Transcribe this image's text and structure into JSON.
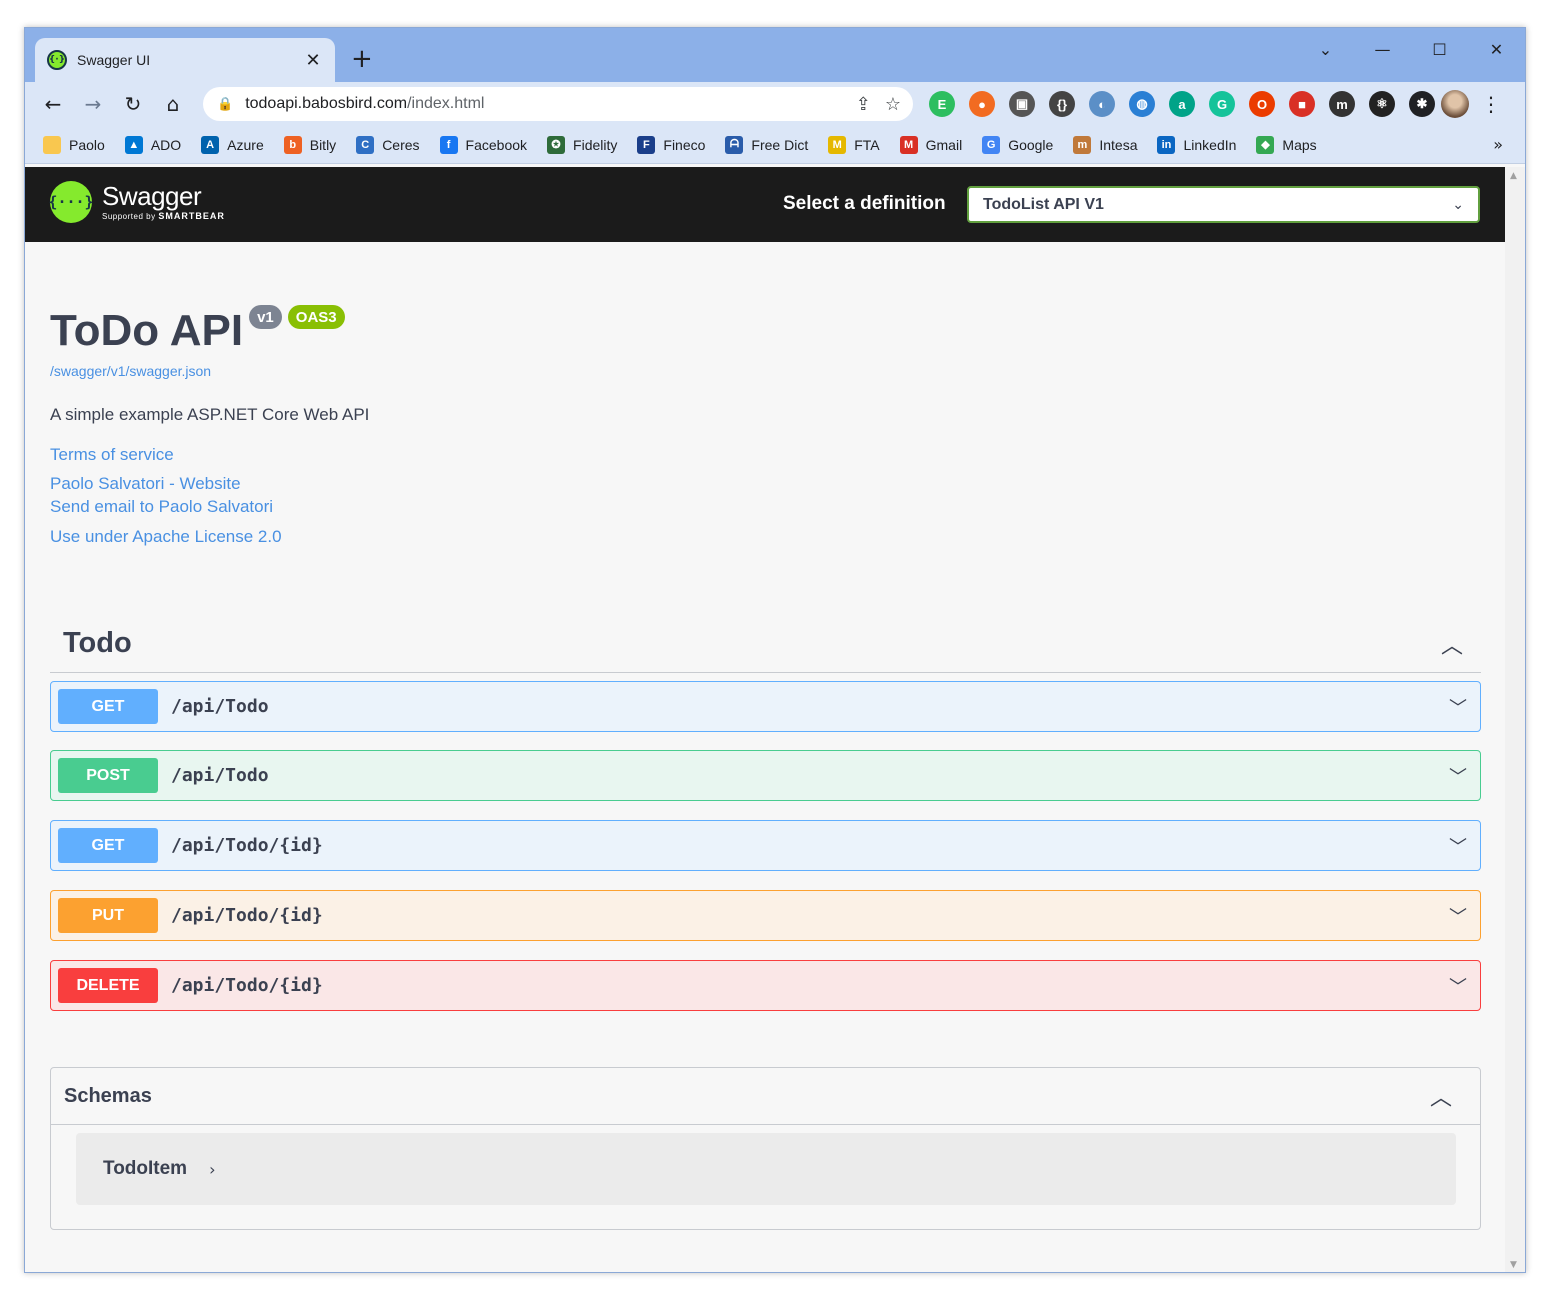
{
  "browser": {
    "tab_title": "Swagger UI",
    "tab_close": "✕",
    "new_tab": "+",
    "window_controls": [
      "⌄",
      "—",
      "☐",
      "✕"
    ],
    "url_host": "todoapi.babosbird.com",
    "url_path": "/index.html",
    "nav": {
      "back": "←",
      "forward": "→",
      "reload": "↻",
      "home": "⌂"
    },
    "lock_icon": "🔒",
    "share_icon": "⇪",
    "star_icon": "☆",
    "extensions": [
      {
        "name": "evernote-icon",
        "glyph": "E",
        "color": "#2dbe60"
      },
      {
        "name": "orange-ext-icon",
        "glyph": "●",
        "color": "#f26b21"
      },
      {
        "name": "grey-ext-icon",
        "glyph": "▣",
        "color": "#555555"
      },
      {
        "name": "swagger-ext-icon",
        "glyph": "{}",
        "color": "#444444"
      },
      {
        "name": "edge-ext-icon",
        "glyph": "◐",
        "color": "#5b8fc7"
      },
      {
        "name": "globe-ext-icon",
        "glyph": "◍",
        "color": "#2a7fd4"
      },
      {
        "name": "a-ext-icon",
        "glyph": "a",
        "color": "#00a388"
      },
      {
        "name": "grammarly-icon",
        "glyph": "G",
        "color": "#15c39a"
      },
      {
        "name": "office-icon",
        "glyph": "O",
        "color": "#eb3c00"
      },
      {
        "name": "red-ext-icon",
        "glyph": "■",
        "color": "#d93025"
      },
      {
        "name": "m-ext-icon",
        "glyph": "m",
        "color": "#333333"
      },
      {
        "name": "react-ext-icon",
        "glyph": "⚛",
        "color": "#222222"
      },
      {
        "name": "puzzle-icon",
        "glyph": "✱",
        "color": "#202124"
      }
    ],
    "bookmarks": [
      {
        "label": "Paolo",
        "icon": "folder-icon",
        "glyph": "",
        "color": "#f9c74f"
      },
      {
        "label": "ADO",
        "icon": "ado-icon",
        "glyph": "▲",
        "color": "#0078d4"
      },
      {
        "label": "Azure",
        "icon": "azure-icon",
        "glyph": "A",
        "color": "#0062ad"
      },
      {
        "label": "Bitly",
        "icon": "bitly-icon",
        "glyph": "b",
        "color": "#ee6123"
      },
      {
        "label": "Ceres",
        "icon": "ceres-icon",
        "glyph": "C",
        "color": "#2f6fc4"
      },
      {
        "label": "Facebook",
        "icon": "facebook-icon",
        "glyph": "f",
        "color": "#1877f2"
      },
      {
        "label": "Fidelity",
        "icon": "fidelity-icon",
        "glyph": "✪",
        "color": "#2e6b3a"
      },
      {
        "label": "Fineco",
        "icon": "fineco-icon",
        "glyph": "F",
        "color": "#1a3e8a"
      },
      {
        "label": "Free Dict",
        "icon": "freedict-icon",
        "glyph": "ᗩ",
        "color": "#2a5caa"
      },
      {
        "label": "FTA",
        "icon": "fta-icon",
        "glyph": "M",
        "color": "#e5b800"
      },
      {
        "label": "Gmail",
        "icon": "gmail-icon",
        "glyph": "M",
        "color": "#d93025"
      },
      {
        "label": "Google",
        "icon": "google-icon",
        "glyph": "G",
        "color": "#4285f4"
      },
      {
        "label": "Intesa",
        "icon": "intesa-icon",
        "glyph": "m",
        "color": "#c0793a"
      },
      {
        "label": "LinkedIn",
        "icon": "linkedin-icon",
        "glyph": "in",
        "color": "#0a66c2"
      },
      {
        "label": "Maps",
        "icon": "maps-icon",
        "glyph": "◆",
        "color": "#34a853"
      }
    ],
    "bookmarks_more": "»"
  },
  "swagger": {
    "logo_name": "Swagger",
    "logo_sub_prefix": "Supported by",
    "logo_sub_brand": "SMARTBEAR",
    "select_label": "Select a definition",
    "select_value": "TodoList API V1"
  },
  "info": {
    "title": "ToDo API",
    "version_badge": "v1",
    "oas_badge": "OAS3",
    "spec_url": "/swagger/v1/swagger.json",
    "description": "A simple example ASP.NET Core Web API",
    "terms": "Terms of service",
    "contact_website": "Paolo Salvatori - Website",
    "contact_email": "Send email to Paolo Salvatori",
    "license": "Use under Apache License 2.0"
  },
  "tag": {
    "name": "Todo",
    "operations": [
      {
        "method": "GET",
        "path": "/api/Todo"
      },
      {
        "method": "POST",
        "path": "/api/Todo"
      },
      {
        "method": "GET",
        "path": "/api/Todo/{id}"
      },
      {
        "method": "PUT",
        "path": "/api/Todo/{id}"
      },
      {
        "method": "DELETE",
        "path": "/api/Todo/{id}"
      }
    ]
  },
  "schemas": {
    "title": "Schemas",
    "models": [
      "TodoItem"
    ]
  }
}
